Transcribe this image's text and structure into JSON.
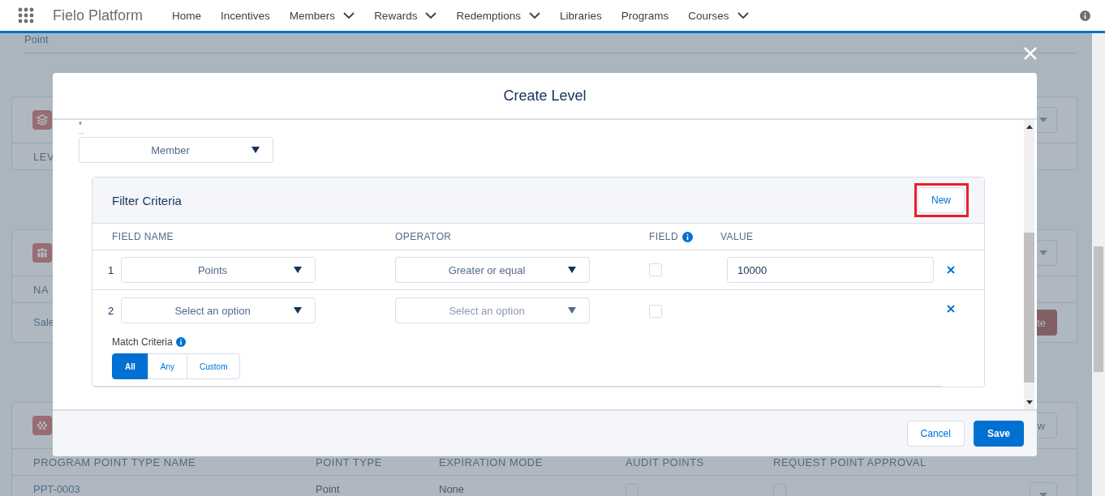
{
  "app": {
    "title": "Fielo Platform",
    "nav": [
      {
        "label": "Home",
        "has_menu": false
      },
      {
        "label": "Incentives",
        "has_menu": false
      },
      {
        "label": "Members",
        "has_menu": true
      },
      {
        "label": "Rewards",
        "has_menu": true
      },
      {
        "label": "Redemptions",
        "has_menu": true
      },
      {
        "label": "Libraries",
        "has_menu": false
      },
      {
        "label": "Programs",
        "has_menu": false
      },
      {
        "label": "Courses",
        "has_menu": true
      }
    ]
  },
  "background": {
    "top_link": "Point",
    "cards": [
      {
        "rows": [
          {
            "kind": "header",
            "cells": [
              "LEV"
            ]
          }
        ]
      },
      {
        "rows": [
          {
            "kind": "header",
            "cells": [
              "NA"
            ]
          },
          {
            "kind": "data",
            "cells": [
              "Sale"
            ],
            "action": "te"
          }
        ]
      },
      {
        "button": "w",
        "rows": [
          {
            "kind": "header",
            "cells": [
              "PROGRAM POINT TYPE NAME",
              "POINT TYPE",
              "EXPIRATION MODE",
              "AUDIT POINTS",
              "REQUEST POINT APPROVAL"
            ]
          },
          {
            "kind": "data",
            "cells": [
              "PPT-0003",
              "Point",
              "None"
            ],
            "checks": [
              false,
              false
            ]
          }
        ]
      }
    ]
  },
  "modal": {
    "title": "Create Level",
    "required_mark": "*",
    "label": "...",
    "select": "Member",
    "filter": {
      "title": "Filter Criteria",
      "new_button": "New",
      "highlighted": true,
      "columns": [
        "FIELD NAME",
        "OPERATOR",
        "FIELD",
        "VALUE"
      ],
      "rows": [
        {
          "number": "1",
          "field": "Points",
          "operator": "Greater or equal",
          "operator_disabled": false,
          "checked": false,
          "value": "10000"
        },
        {
          "number": "2",
          "field": "Select an option",
          "operator": "Select an option",
          "operator_disabled": true,
          "checked": false
        }
      ],
      "match_label": "Match Criteria",
      "match_options": [
        {
          "label": "All",
          "selected": true
        },
        {
          "label": "Any",
          "selected": false
        },
        {
          "label": "Custom",
          "selected": false
        }
      ]
    },
    "buttons": {
      "cancel": "Cancel",
      "save": "Save"
    }
  }
}
